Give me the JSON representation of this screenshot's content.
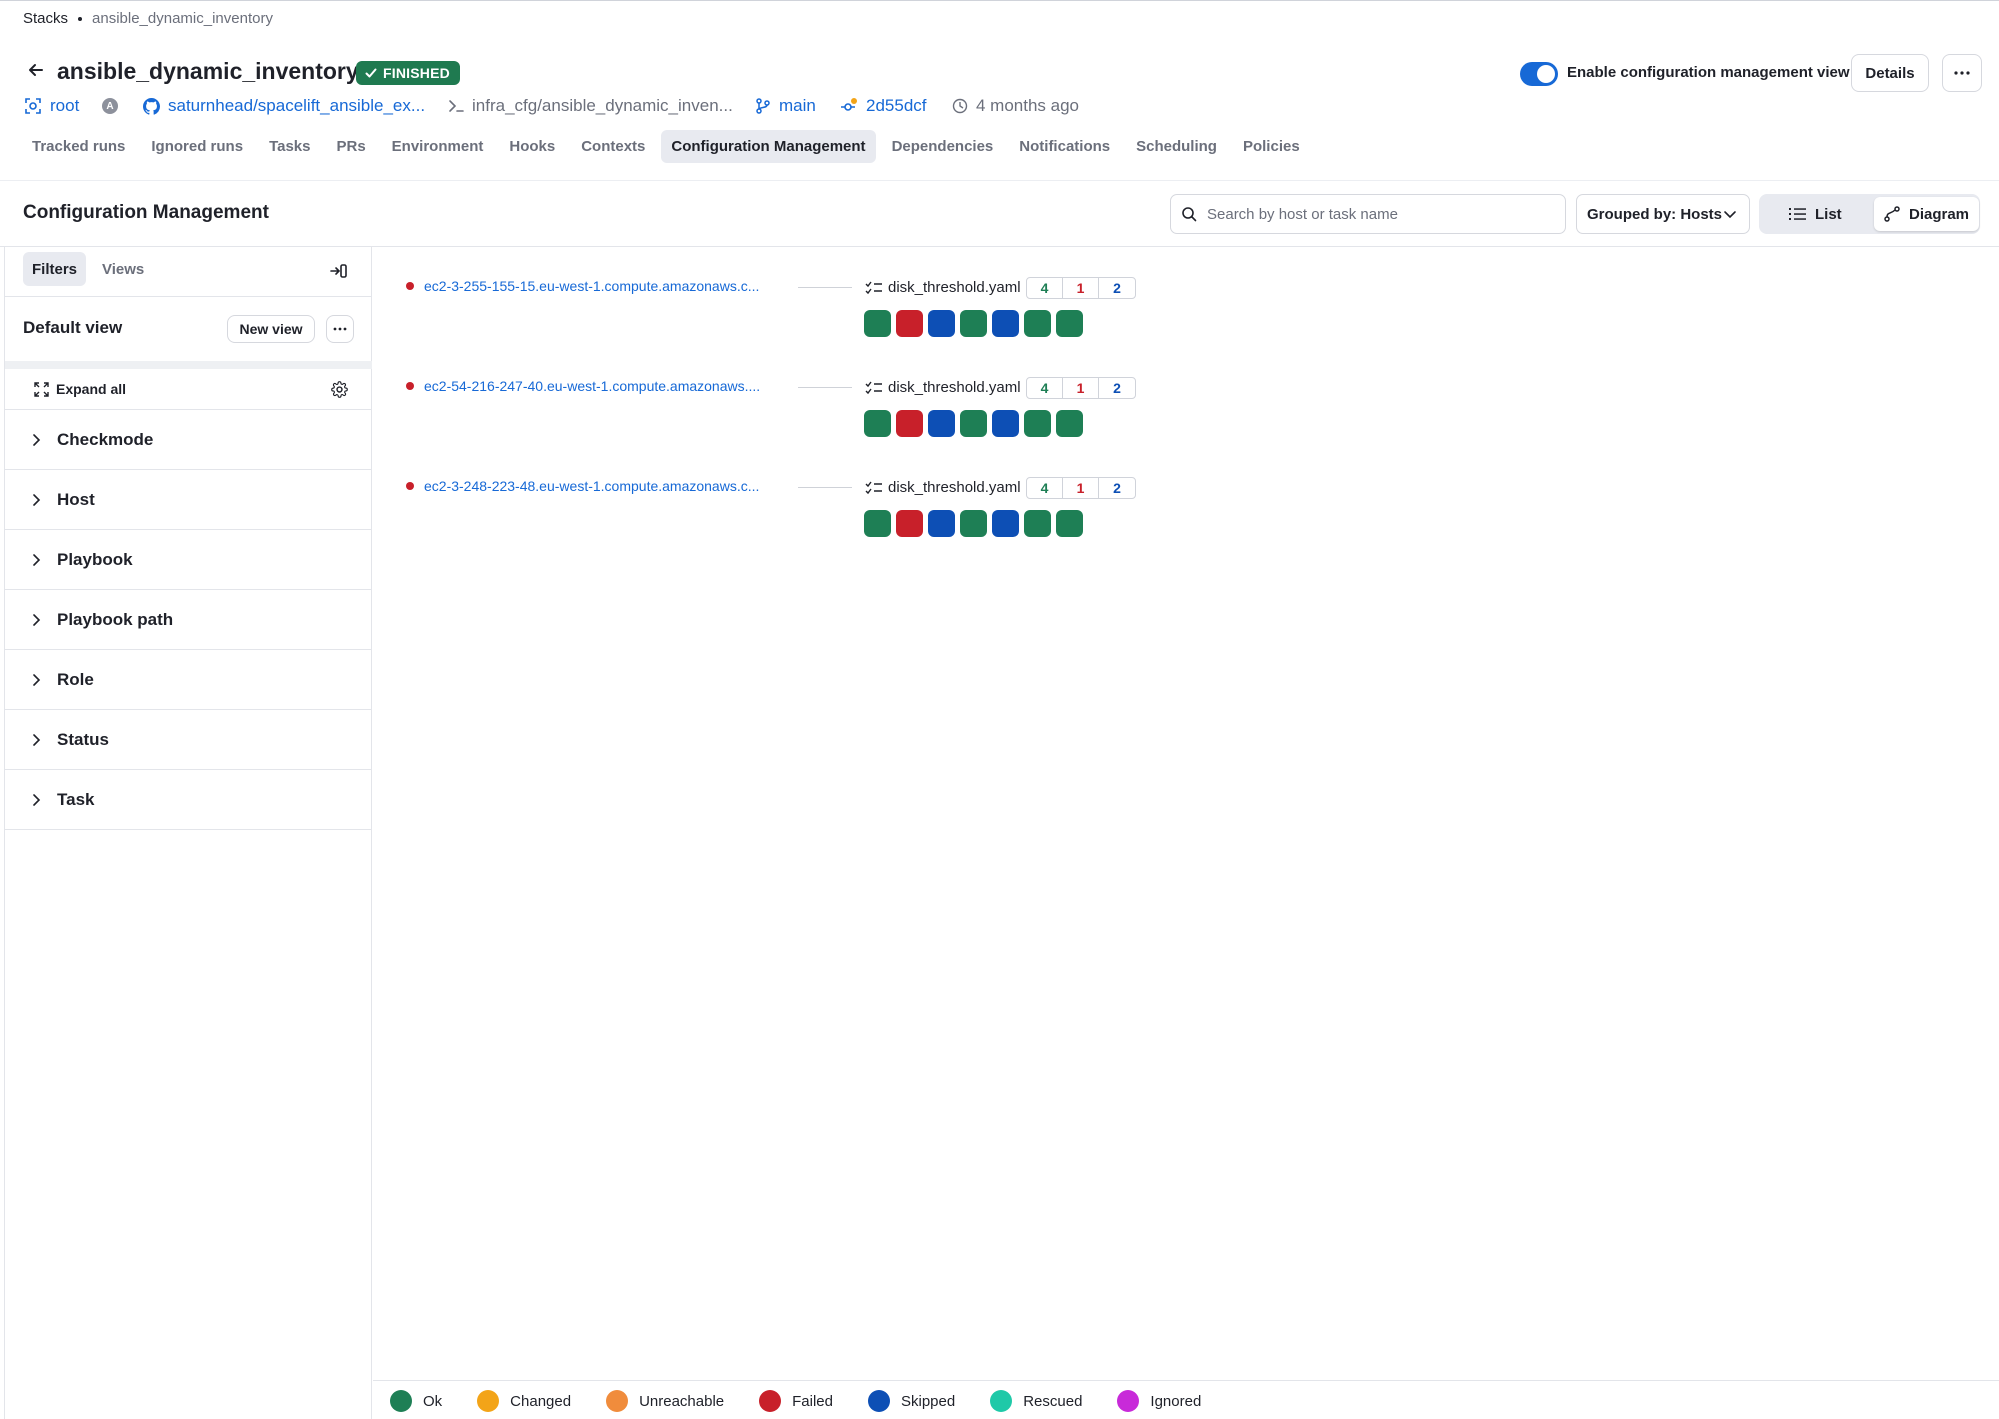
{
  "breadcrumb": {
    "root": "Stacks",
    "current": "ansible_dynamic_inventory"
  },
  "stack": {
    "name": "ansible_dynamic_inventory",
    "status": "FINISHED"
  },
  "meta": {
    "space": "root",
    "avatar_letter": "A",
    "repo": "saturnhead/spacelift_ansible_ex...",
    "path": "infra_cfg/ansible_dynamic_inven...",
    "branch": "main",
    "commit": "2d55dcf",
    "time": "4 months ago"
  },
  "header_actions": {
    "toggle_label": "Enable configuration management view",
    "toggle_on": true,
    "details": "Details"
  },
  "tabs": [
    "Tracked runs",
    "Ignored runs",
    "Tasks",
    "PRs",
    "Environment",
    "Hooks",
    "Contexts",
    "Configuration Management",
    "Dependencies",
    "Notifications",
    "Scheduling",
    "Policies"
  ],
  "active_tab": "Configuration Management",
  "section": {
    "title": "Configuration Management",
    "search_placeholder": "Search by host or task name",
    "group_by": "Grouped by: Hosts",
    "view_list": "List",
    "view_diagram": "Diagram",
    "active_view": "Diagram"
  },
  "sidebar": {
    "tab_filters": "Filters",
    "tab_views": "Views",
    "view_name": "Default view",
    "new_view": "New view",
    "expand_all": "Expand all",
    "filters": [
      "Checkmode",
      "Host",
      "Playbook",
      "Playbook path",
      "Role",
      "Status",
      "Task"
    ]
  },
  "hosts": [
    {
      "name": "ec2-3-255-155-15.eu-west-1.compute.amazonaws.c...",
      "playbook": "disk_threshold.yaml",
      "counts": {
        "ok": "4",
        "failed": "1",
        "skipped": "2"
      },
      "tasks": [
        "ok",
        "failed",
        "skipped",
        "ok",
        "skipped",
        "ok",
        "ok"
      ]
    },
    {
      "name": "ec2-54-216-247-40.eu-west-1.compute.amazonaws....",
      "playbook": "disk_threshold.yaml",
      "counts": {
        "ok": "4",
        "failed": "1",
        "skipped": "2"
      },
      "tasks": [
        "ok",
        "failed",
        "skipped",
        "ok",
        "skipped",
        "ok",
        "ok"
      ]
    },
    {
      "name": "ec2-3-248-223-48.eu-west-1.compute.amazonaws.c...",
      "playbook": "disk_threshold.yaml",
      "counts": {
        "ok": "4",
        "failed": "1",
        "skipped": "2"
      },
      "tasks": [
        "ok",
        "failed",
        "skipped",
        "ok",
        "skipped",
        "ok",
        "ok"
      ]
    }
  ],
  "legend": [
    {
      "key": "ok",
      "label": "Ok",
      "color": "#1e7f55"
    },
    {
      "key": "changed",
      "label": "Changed",
      "color": "#f3a418"
    },
    {
      "key": "unreachable",
      "label": "Unreachable",
      "color": "#f08c3c"
    },
    {
      "key": "failed",
      "label": "Failed",
      "color": "#c8202a"
    },
    {
      "key": "skipped",
      "label": "Skipped",
      "color": "#0d4fb5"
    },
    {
      "key": "rescued",
      "label": "Rescued",
      "color": "#1fc9a8"
    },
    {
      "key": "ignored",
      "label": "Ignored",
      "color": "#c82ad9"
    }
  ],
  "colors": {
    "accent": "#1769d6",
    "status_finished": "#1f7a50",
    "count_ok": "#1e7f55",
    "count_failed": "#c8202a",
    "count_skipped": "#0d4fb5"
  }
}
